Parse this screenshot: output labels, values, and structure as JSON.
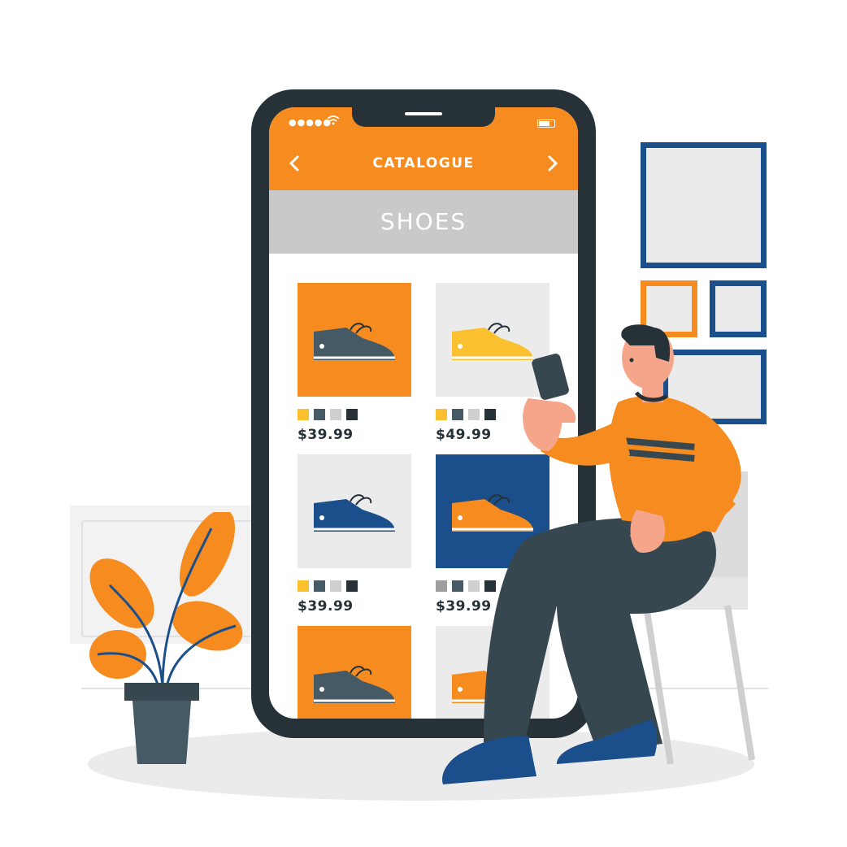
{
  "header": {
    "title": "CATALOGUE"
  },
  "category": {
    "title": "SHOES"
  },
  "products": [
    {
      "price": "$39.99",
      "bg": "#f68b1f",
      "shoe": "#455a64",
      "swatches": [
        "#fbc02d",
        "#455a64",
        "#cfcfcf",
        "#263238"
      ]
    },
    {
      "price": "$49.99",
      "bg": "#ebebeb",
      "shoe": "#fbc02d",
      "swatches": [
        "#fbc02d",
        "#455a64",
        "#cfcfcf",
        "#263238"
      ]
    },
    {
      "price": "$39.99",
      "bg": "#ebebeb",
      "shoe": "#1a4f8c",
      "swatches": [
        "#fbc02d",
        "#455a64",
        "#cfcfcf",
        "#263238"
      ]
    },
    {
      "price": "$39.99",
      "bg": "#1a4f8c",
      "shoe": "#f68b1f",
      "swatches": [
        "#9e9e9e",
        "#455a64",
        "#cfcfcf",
        "#263238"
      ]
    },
    {
      "price": "",
      "bg": "#f68b1f",
      "shoe": "#455a64",
      "swatches": []
    },
    {
      "price": "",
      "bg": "#ebebeb",
      "shoe": "#f68b1f",
      "swatches": []
    }
  ],
  "colors": {
    "accent": "#f68b1f",
    "dark": "#263238",
    "blue": "#1a4f8c",
    "grey": "#c9c9c9"
  },
  "icons": [
    "back-chevron-icon",
    "forward-chevron-icon",
    "wifi-icon",
    "battery-icon",
    "signal-icon"
  ]
}
